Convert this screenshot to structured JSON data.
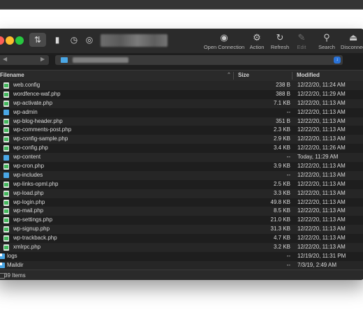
{
  "toolbar": {
    "tools": [
      {
        "label": "Open Connection",
        "icon": "globe-plus-icon"
      },
      {
        "label": "Action",
        "icon": "gear-icon"
      },
      {
        "label": "Refresh",
        "icon": "refresh-icon"
      },
      {
        "label": "Edit",
        "icon": "pencil-icon"
      },
      {
        "label": "Search",
        "icon": "search-icon"
      },
      {
        "label": "Disconnect",
        "icon": "eject-icon"
      }
    ]
  },
  "columns": {
    "filename": "Filename",
    "size": "Size",
    "modified": "Modified"
  },
  "files": [
    {
      "name": "web.config",
      "type": "file",
      "size": "238 B",
      "modified": "12/22/20, 11:24 AM"
    },
    {
      "name": "wordfence-waf.php",
      "type": "file",
      "size": "388 B",
      "modified": "12/22/20, 11:29 AM"
    },
    {
      "name": "wp-activate.php",
      "type": "file",
      "size": "7.1 KB",
      "modified": "12/22/20, 11:13 AM"
    },
    {
      "name": "wp-admin",
      "type": "folder",
      "size": "--",
      "modified": "12/22/20, 11:13 AM"
    },
    {
      "name": "wp-blog-header.php",
      "type": "file",
      "size": "351 B",
      "modified": "12/22/20, 11:13 AM"
    },
    {
      "name": "wp-comments-post.php",
      "type": "file",
      "size": "2.3 KB",
      "modified": "12/22/20, 11:13 AM"
    },
    {
      "name": "wp-config-sample.php",
      "type": "file",
      "size": "2.9 KB",
      "modified": "12/22/20, 11:13 AM"
    },
    {
      "name": "wp-config.php",
      "type": "file",
      "size": "3.4 KB",
      "modified": "12/22/20, 11:26 AM"
    },
    {
      "name": "wp-content",
      "type": "folder",
      "size": "--",
      "modified": "Today, 11:29 AM"
    },
    {
      "name": "wp-cron.php",
      "type": "file",
      "size": "3.9 KB",
      "modified": "12/22/20, 11:13 AM"
    },
    {
      "name": "wp-includes",
      "type": "folder",
      "size": "--",
      "modified": "12/22/20, 11:13 AM"
    },
    {
      "name": "wp-links-opml.php",
      "type": "file",
      "size": "2.5 KB",
      "modified": "12/22/20, 11:13 AM"
    },
    {
      "name": "wp-load.php",
      "type": "file",
      "size": "3.3 KB",
      "modified": "12/22/20, 11:13 AM"
    },
    {
      "name": "wp-login.php",
      "type": "file",
      "size": "49.8 KB",
      "modified": "12/22/20, 11:13 AM"
    },
    {
      "name": "wp-mail.php",
      "type": "file",
      "size": "8.5 KB",
      "modified": "12/22/20, 11:13 AM"
    },
    {
      "name": "wp-settings.php",
      "type": "file",
      "size": "21.0 KB",
      "modified": "12/22/20, 11:13 AM"
    },
    {
      "name": "wp-signup.php",
      "type": "file",
      "size": "31.3 KB",
      "modified": "12/22/20, 11:13 AM"
    },
    {
      "name": "wp-trackback.php",
      "type": "file",
      "size": "4.7 KB",
      "modified": "12/22/20, 11:13 AM"
    },
    {
      "name": "xmlrpc.php",
      "type": "file",
      "size": "3.2 KB",
      "modified": "12/22/20, 11:13 AM"
    },
    {
      "name": "logs",
      "type": "link",
      "size": "--",
      "modified": "12/19/20, 11:31 PM"
    },
    {
      "name": "Maildir",
      "type": "link",
      "size": "--",
      "modified": "7/3/19, 2:49 AM"
    }
  ],
  "status": {
    "text": "39 Items"
  }
}
